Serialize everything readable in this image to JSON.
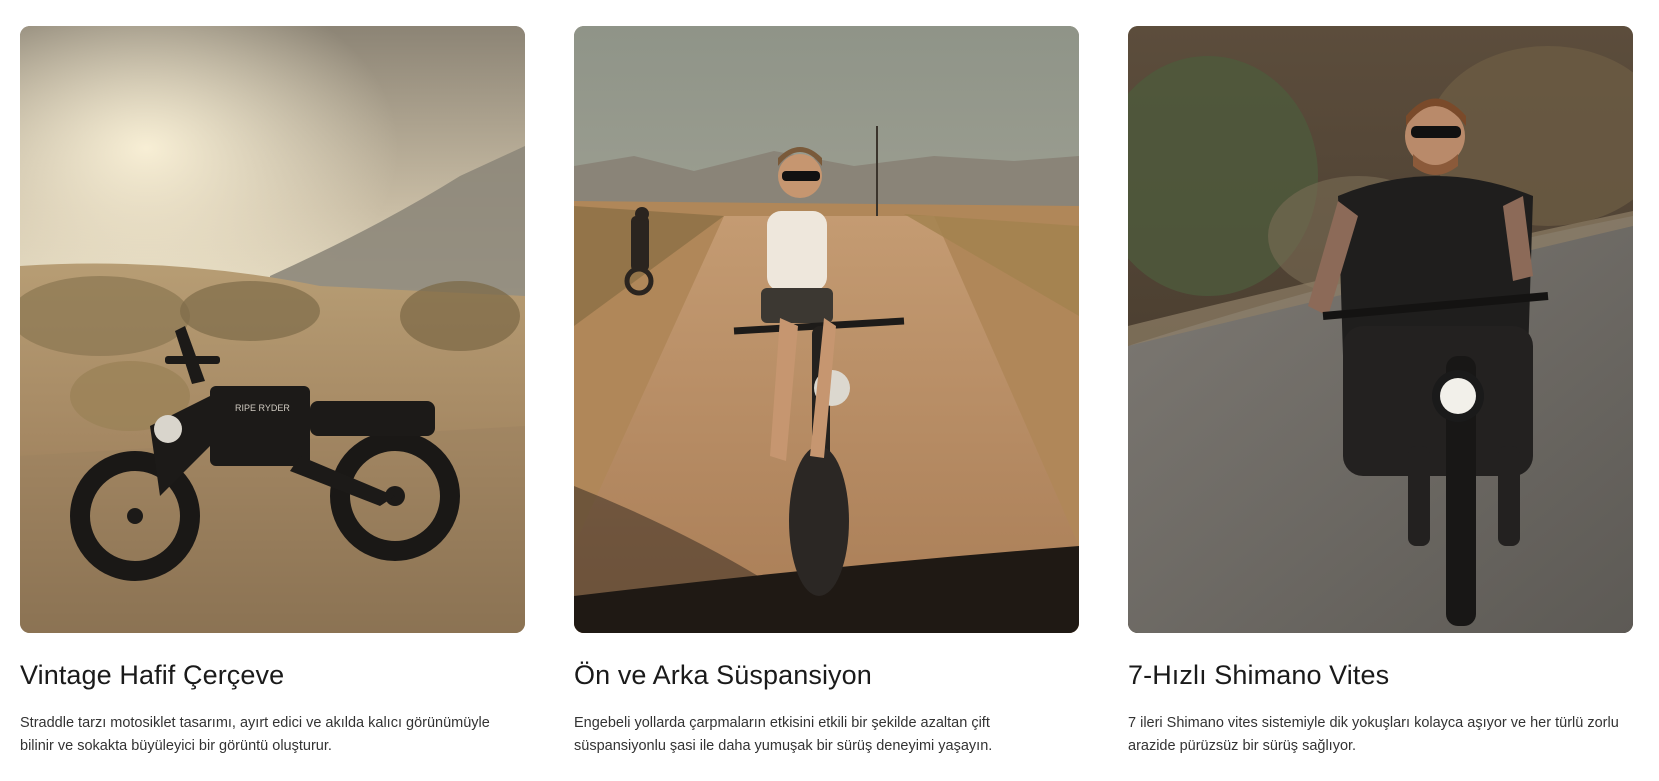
{
  "features": [
    {
      "id": "frame",
      "title": "Vintage Hafif Çerçeve",
      "description": "Straddle tarzı motosiklet tasarımı, ayırt edici ve akılda kalıcı görünümüyle bilinir ve sokakta büyüleyici bir görüntü oluşturur.",
      "image_subject": "black e-bike parked on desert sand at sunset",
      "badge_text": "RIPE RYDER"
    },
    {
      "id": "suspension",
      "title": "Ön ve Arka Süspansiyon",
      "description": "Engebeli yollarda çarpmaların etkisini etkili bir şekilde azaltan çift süspansiyonlu şasi ile daha yumuşak bir sürüş deneyimi yaşayın.",
      "image_subject": "woman riding e-bike on dirt road with riders behind"
    },
    {
      "id": "gears",
      "title": "7-Hızlı Shimano Vites",
      "description": "7 ileri Shimano vites sistemiyle dik yokuşları kolayca aşıyor ve her türlü zorlu arazide pürüzsüz bir sürüş sağlıyor.",
      "image_subject": "tattooed man riding e-bike on asphalt road"
    }
  ],
  "colors": {
    "title": "#1a1a1a",
    "text": "#333333",
    "background": "#ffffff"
  }
}
